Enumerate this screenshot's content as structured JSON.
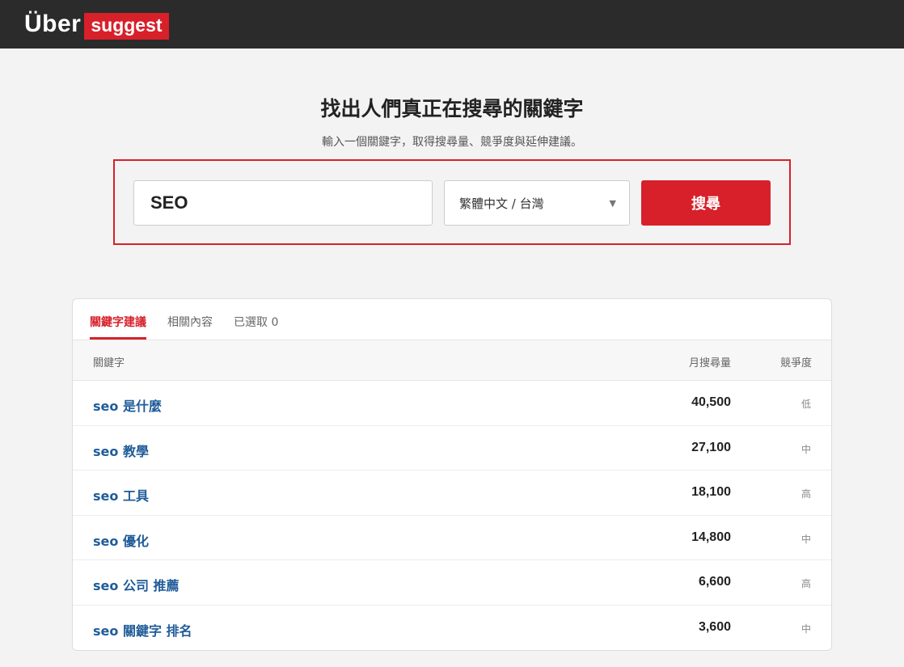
{
  "header": {
    "logo_uber": "Über",
    "logo_suggest": "suggest"
  },
  "hero": {
    "headline": "找出人們真正在搜尋的關鍵字",
    "subline": "輸入一個關鍵字，取得搜尋量、競爭度與延伸建議。"
  },
  "search": {
    "keyword_value": "SEO",
    "language_selected": "繁體中文 / 台灣",
    "button_label": "搜尋"
  },
  "tabs": [
    {
      "label": "關鍵字建議",
      "active": true
    },
    {
      "label": "相關內容",
      "active": false
    },
    {
      "label": "已選取 0",
      "active": false
    }
  ],
  "table": {
    "headers": {
      "keyword": "關鍵字",
      "volume": "月搜尋量",
      "competition": "競爭度"
    },
    "rows": [
      {
        "keyword": "seo 是什麼",
        "volume": "40,500",
        "competition": "低"
      },
      {
        "keyword": "seo 教學",
        "volume": "27,100",
        "competition": "中"
      },
      {
        "keyword": "seo 工具",
        "volume": "18,100",
        "competition": "高"
      },
      {
        "keyword": "seo 優化",
        "volume": "14,800",
        "competition": "中"
      },
      {
        "keyword": "seo 公司 推薦",
        "volume": "6,600",
        "competition": "高"
      },
      {
        "keyword": "seo 關鍵字 排名",
        "volume": "3,600",
        "competition": "中"
      }
    ]
  },
  "colors": {
    "accent": "#d7202a",
    "link": "#1f5c99",
    "topbar": "#2b2b2b"
  }
}
